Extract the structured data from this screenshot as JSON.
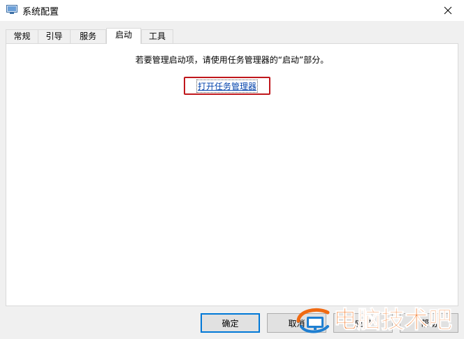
{
  "window": {
    "title": "系统配置",
    "close_symbol": "✕",
    "app_icon": "system-config-icon"
  },
  "tabs": [
    {
      "label": "常规",
      "active": false
    },
    {
      "label": "引导",
      "active": false
    },
    {
      "label": "服务",
      "active": false
    },
    {
      "label": "启动",
      "active": true
    },
    {
      "label": "工具",
      "active": false
    }
  ],
  "startup": {
    "instruction": "若要管理启动项，请使用任务管理器的“启动”部分。",
    "link_label": "打开任务管理器",
    "highlight_color": "#c0171c"
  },
  "buttons": {
    "ok": "确定",
    "cancel": "取消",
    "apply": "应用",
    "help": "帮助"
  },
  "watermark": {
    "text": "电脑技术吧",
    "color": "#f06a12"
  }
}
